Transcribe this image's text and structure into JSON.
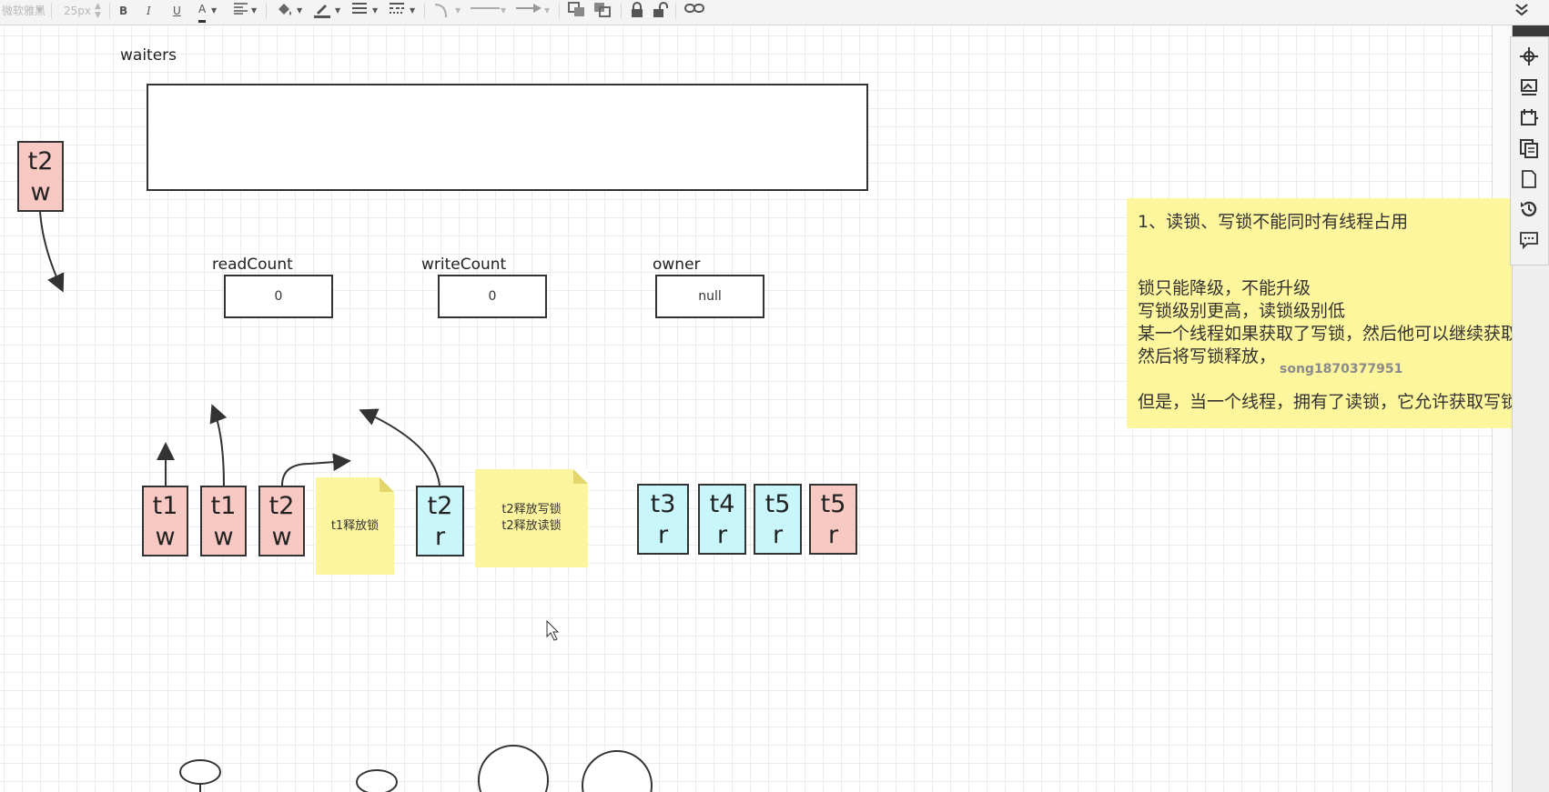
{
  "toolbar": {
    "font_name": "微软雅黑",
    "font_size": "25px",
    "bold": "B",
    "italic": "I",
    "underline": "U",
    "font_color": "A"
  },
  "canvas": {
    "waiters_label": "waiters",
    "fields": [
      {
        "label": "readCount",
        "value": "0"
      },
      {
        "label": "writeCount",
        "value": "0"
      },
      {
        "label": "owner",
        "value": "null"
      }
    ],
    "side_node": {
      "top": "t2",
      "bottom": "w"
    },
    "nodes": [
      {
        "top": "t1",
        "bottom": "w",
        "color": "#f8c8c3"
      },
      {
        "top": "t1",
        "bottom": "w",
        "color": "#f8c8c3"
      },
      {
        "top": "t2",
        "bottom": "w",
        "color": "#f8c8c3"
      },
      {
        "top": "t2",
        "bottom": "r",
        "color": "#c9f6fb"
      },
      {
        "top": "t3",
        "bottom": "r",
        "color": "#c9f6fb"
      },
      {
        "top": "t4",
        "bottom": "r",
        "color": "#c9f6fb"
      },
      {
        "top": "t5",
        "bottom": "r",
        "color": "#c9f6fb"
      },
      {
        "top": "t5",
        "bottom": "r",
        "color": "#f8c8c3"
      }
    ],
    "sticky_notes": [
      {
        "lines": [
          "t1释放锁"
        ]
      },
      {
        "lines": [
          "t2释放写锁",
          "t2释放读锁"
        ]
      }
    ],
    "big_note": {
      "line1": "1、读锁、写锁不能同时有线程占用",
      "line2": "锁只能降级，不能升级",
      "line3": "写锁级别更高，读锁级别低",
      "line4": "某一个线程如果获取了写锁，然后他可以继续获取读",
      "line5": "然后将写锁释放，",
      "line6": "但是，当一个线程，拥有了读锁，它允许获取写锁"
    },
    "watermark": "song1870377951"
  },
  "right_panel": {
    "icons": [
      "navigation-icon",
      "image-icon",
      "page-setup-icon",
      "copy-icon",
      "page-icon",
      "history-icon",
      "comment-icon"
    ]
  },
  "colors": {
    "pink": "#f8c8c3",
    "cyan": "#c9f6fb",
    "note_yellow": "#fdf49e"
  }
}
